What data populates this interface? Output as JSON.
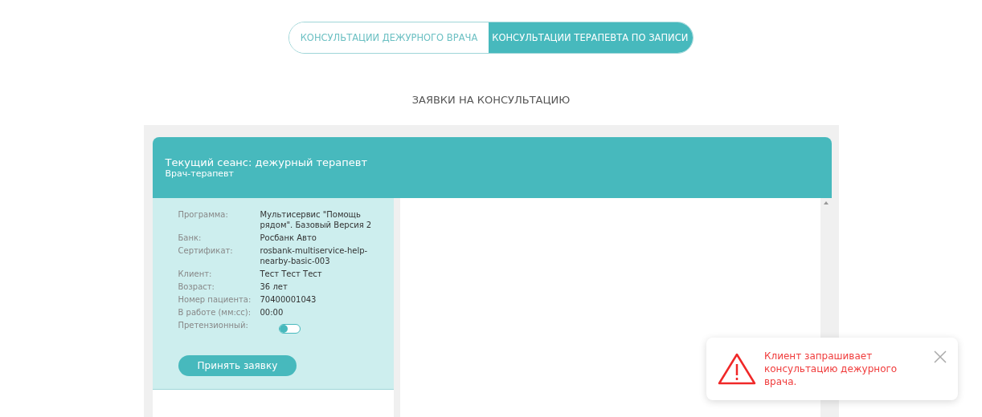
{
  "tabs": [
    {
      "label": "КОНСУЛЬТАЦИИ ДЕЖУРНОГО ВРАЧА",
      "selected": false
    },
    {
      "label": "КОНСУЛЬТАЦИИ ТЕРАПЕВТА ПО ЗАПИСИ",
      "selected": true
    }
  ],
  "heading": "ЗАЯВКИ НА КОНСУЛЬТАЦИЮ",
  "session": {
    "title": "Текущий сеанс: дежурный терапевт",
    "subtitle": "Врач-терапевт",
    "fields": [
      {
        "label": "Программа:",
        "value": "Мультисервис \"Помощь рядом\". Базовый Версия 2"
      },
      {
        "label": "Банк:",
        "value": "Росбанк Авто"
      },
      {
        "label": "Сертификат:",
        "value": "rosbank-multiservice-help-nearby-basic-003"
      },
      {
        "label": "Клиент:",
        "value": "Тест Тест Тест"
      },
      {
        "label": "Возраст:",
        "value": "36 лет"
      },
      {
        "label": "Номер пациента:",
        "value": "70400001043"
      },
      {
        "label": "В работе (мм:сс):",
        "value": "00:00"
      }
    ],
    "claim_toggle": {
      "label": "Претензионный:",
      "on": false
    },
    "accept_button": "Принять заявку"
  },
  "toast": {
    "message": "Клиент запрашивает консультацию дежурного врача."
  }
}
